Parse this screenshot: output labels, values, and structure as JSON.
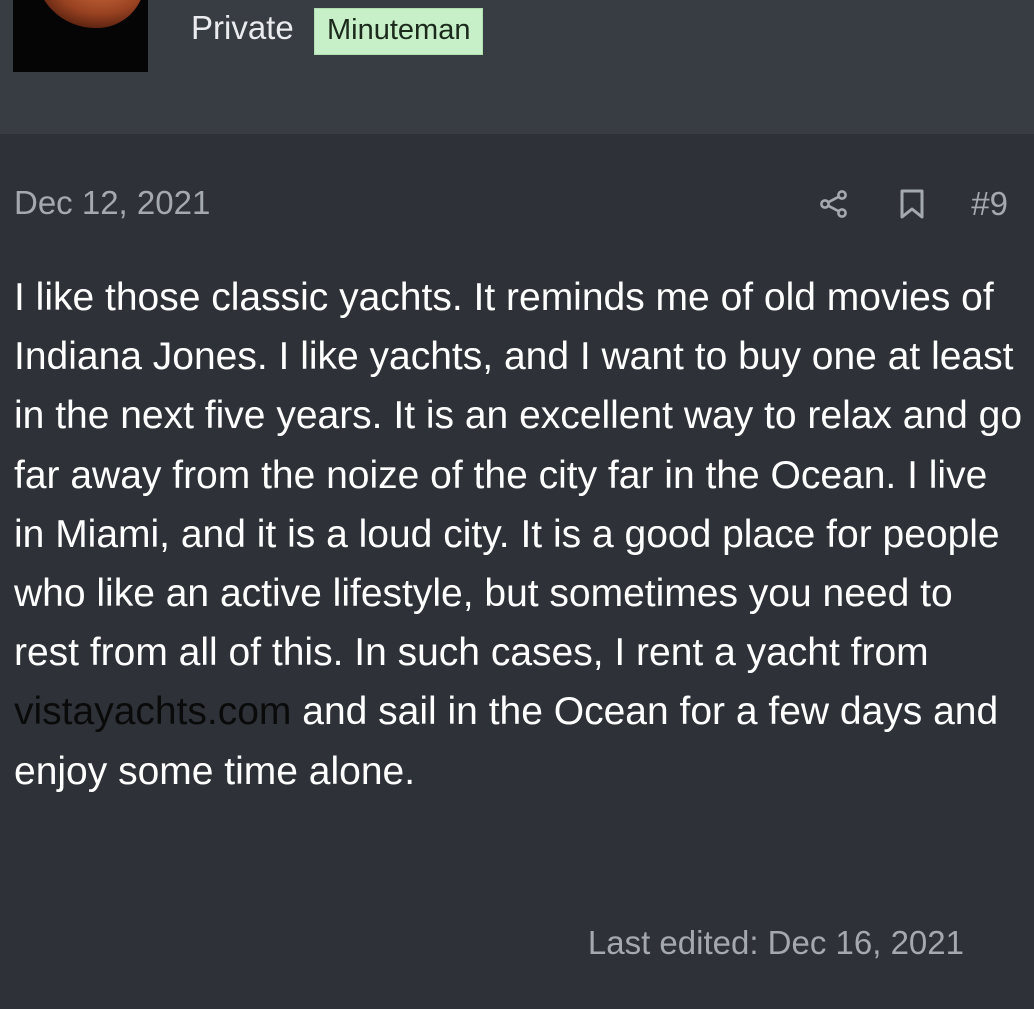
{
  "user": {
    "title": "Private",
    "badge": "Minuteman"
  },
  "post": {
    "date": "Dec 12, 2021",
    "number": "#9",
    "body_part1": "I like those classic yachts. It reminds me of old movies of Indiana Jones. I like yachts, and I want to buy one at least in the next five years. It is an excellent way to relax and go far away from the noize of the city far in the Ocean. I live in Miami, and it is a loud city. It is a good place for people who like an active lifestyle, but sometimes you need to rest from all of this. In such cases, I rent a yacht from ",
    "link_text": "vistayachts.com",
    "body_part2": " and sail in the Ocean for a few days and enjoy some time alone.",
    "last_edited": "Last edited: Dec 16, 2021"
  },
  "icons": {
    "share": "share-icon",
    "bookmark": "bookmark-icon"
  },
  "colors": {
    "background": "#2e3238",
    "header_background": "#383d44",
    "badge_background": "#c8f0c8",
    "muted_text": "#a4a9b0",
    "link_text": "#0a0a0a"
  }
}
